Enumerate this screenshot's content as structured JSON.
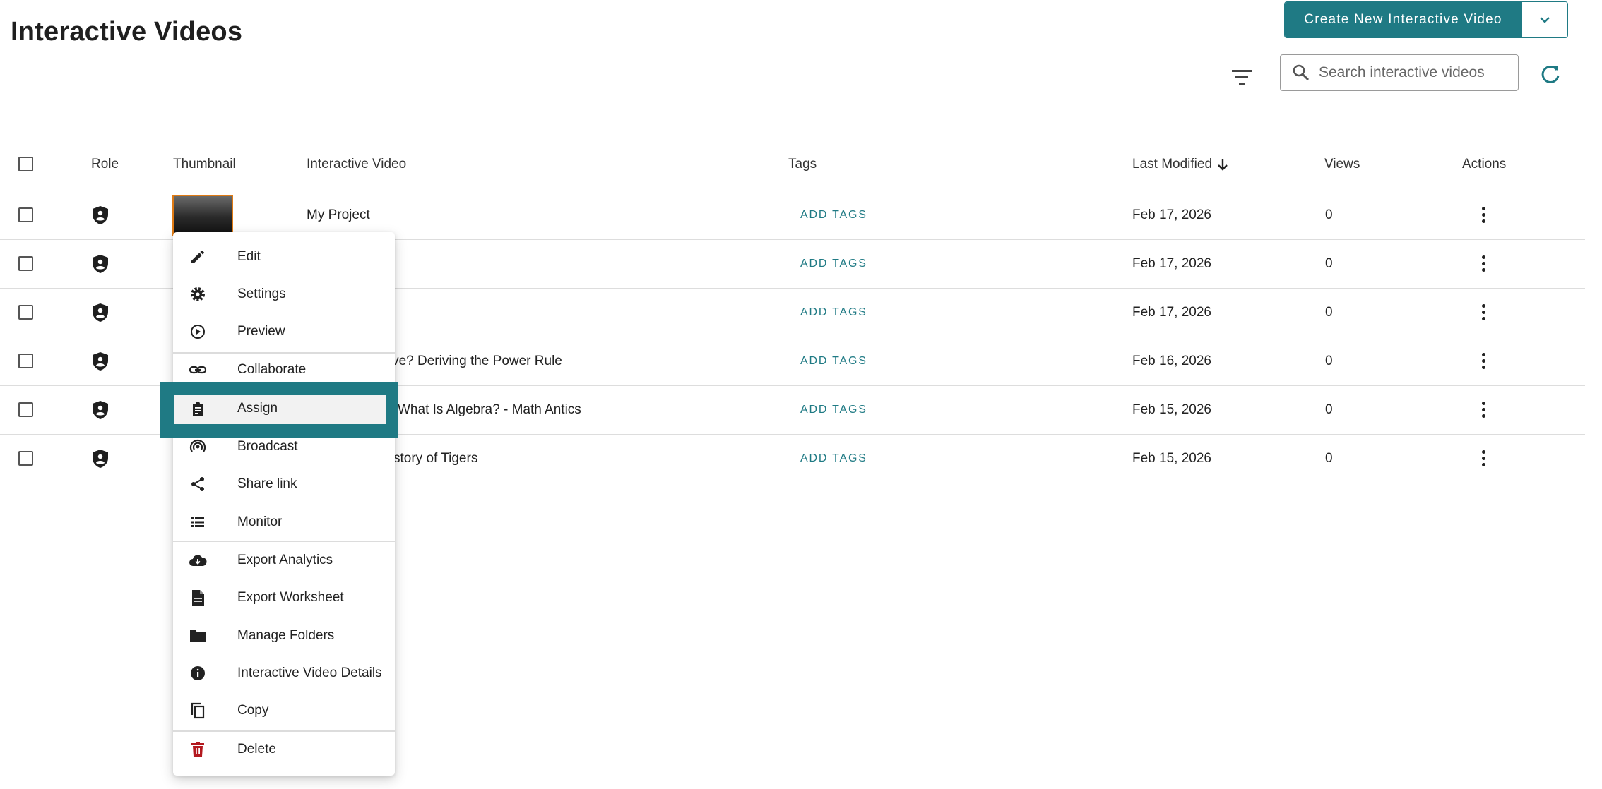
{
  "header": {
    "title": "Interactive Videos",
    "create_label": "Create New Interactive Video",
    "search_placeholder": "Search interactive videos"
  },
  "table": {
    "columns": {
      "role": "Role",
      "thumbnail": "Thumbnail",
      "video": "Interactive Video",
      "tags": "Tags",
      "modified": "Last Modified",
      "views": "Views",
      "actions": "Actions"
    },
    "rows": [
      {
        "title": "My Project",
        "tags": "ADD TAGS",
        "modified": "Feb 17, 2026",
        "views": "0"
      },
      {
        "title": "",
        "tags": "ADD TAGS",
        "modified": "Feb 17, 2026",
        "views": "0"
      },
      {
        "title": "",
        "tags": "ADD TAGS",
        "modified": "Feb 17, 2026",
        "views": "0"
      },
      {
        "title": "ative? Deriving the Power Rule",
        "tags": "ADD TAGS",
        "modified": "Feb 16, 2026",
        "views": "0"
      },
      {
        "title": "What Is Algebra? - Math Antics",
        "tags": "ADD TAGS",
        "modified": "Feb 15, 2026",
        "views": "0"
      },
      {
        "title": "story of Tigers",
        "tags": "ADD TAGS",
        "modified": "Feb 15, 2026",
        "views": "0"
      }
    ]
  },
  "menu": {
    "items": [
      {
        "label": "Edit",
        "icon": "pencil-icon"
      },
      {
        "label": "Settings",
        "icon": "gear-icon"
      },
      {
        "label": "Preview",
        "icon": "play-circle-icon"
      },
      {
        "label": "Collaborate",
        "icon": "link-icon"
      },
      {
        "label": "Assign",
        "icon": "clipboard-icon"
      },
      {
        "label": "Broadcast",
        "icon": "broadcast-icon"
      },
      {
        "label": "Share link",
        "icon": "share-icon"
      },
      {
        "label": "Monitor",
        "icon": "list-icon"
      },
      {
        "label": "Export Analytics",
        "icon": "cloud-download-icon"
      },
      {
        "label": "Export Worksheet",
        "icon": "document-icon"
      },
      {
        "label": "Manage Folders",
        "icon": "folder-icon"
      },
      {
        "label": "Interactive Video Details",
        "icon": "info-icon"
      },
      {
        "label": "Copy",
        "icon": "copy-icon"
      },
      {
        "label": "Delete",
        "icon": "trash-icon"
      }
    ],
    "highlighted": "Assign"
  },
  "colors": {
    "accent": "#1f7a84",
    "thumbnail_border": "#e07b14",
    "delete": "#b3191f"
  }
}
